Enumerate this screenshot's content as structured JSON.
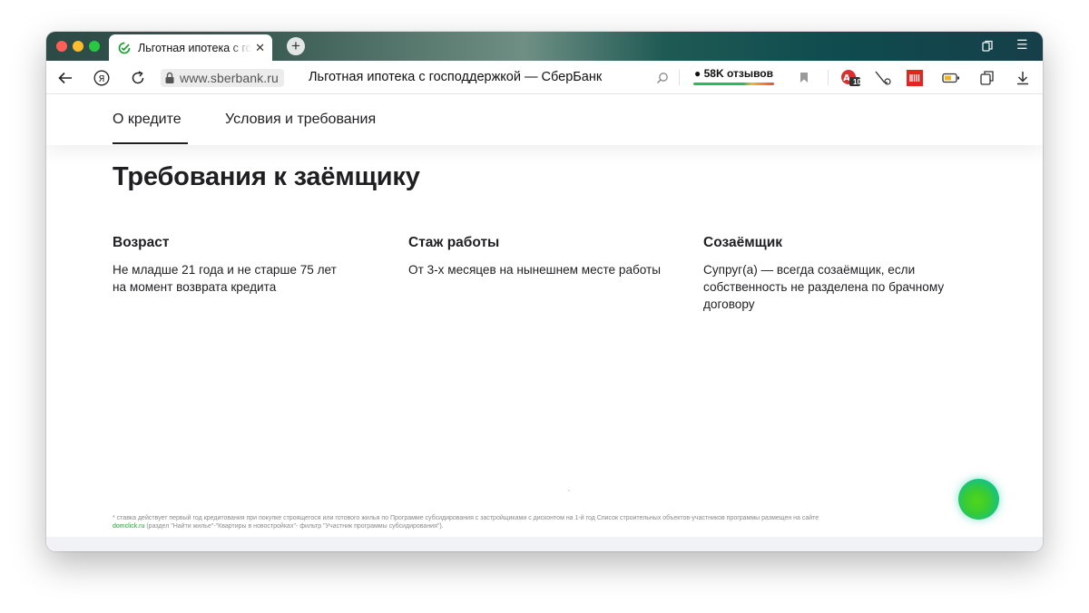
{
  "browser": {
    "tab": {
      "title": "Льготная ипотека с господдержкой — СберБанк",
      "close": "✕"
    },
    "new_tab": "+",
    "menu_icon": "☰",
    "address": {
      "domain": "www.sberbank.ru",
      "page_title": "Льготная ипотека с господдержкой — СберБанк"
    },
    "reviews": {
      "label": "58K отзывов"
    },
    "badges": {
      "extension_count": "10"
    }
  },
  "site": {
    "nav": {
      "tabs": [
        {
          "label": "О кредите",
          "active": true
        },
        {
          "label": "Условия и требования",
          "active": false
        }
      ]
    },
    "section": {
      "title": "Требования к заёмщику",
      "columns": [
        {
          "heading": "Возраст",
          "text": "Не младше 21 года и не старше 75 лет на момент возврата кредита"
        },
        {
          "heading": "Стаж работы",
          "text": "От 3-х месяцев на нынешнем месте работы"
        },
        {
          "heading": "Созаёмщик",
          "text": "Супруг(а) — всегда созаёмщик, если собственность не разделена по брачному договору"
        }
      ]
    },
    "footnote": {
      "text": "* ставка действует первый год кредитования при покупке строящегося или готового жилья по Программе субсидирования с застройщиками с дисконтом на 1-й год Список строительных объектов-участников программы размещен на сайте",
      "link": "domclick.ru",
      "tail": " (раздел \"Найти жилье\"-\"Квартиры в новостройках\"- фильтр \"Участник программы субсидирования\")."
    }
  },
  "colors": {
    "sber_green": "#21a038",
    "text_dark": "#1f1f22"
  },
  "icons": [
    "back-icon",
    "yandex-icon",
    "reload-icon",
    "lock-icon",
    "search-icon",
    "bookmark-icon",
    "translate-icon",
    "tools-icon",
    "barcode-icon",
    "battery-icon",
    "collections-icon",
    "download-icon",
    "sidebar-icon",
    "menu-icon",
    "sber-logo-icon",
    "assistant-icon"
  ]
}
